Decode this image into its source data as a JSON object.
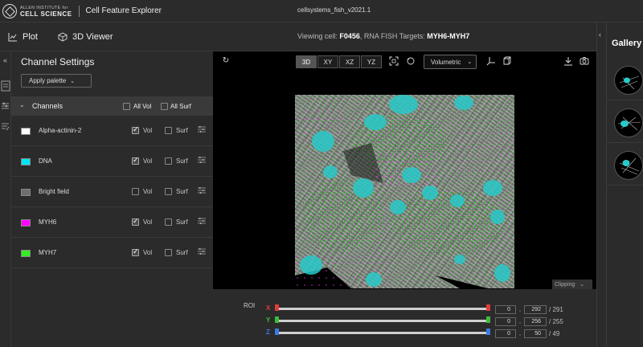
{
  "header": {
    "logo_small": "ALLEN INSTITUTE for",
    "logo_big": "CELL SCIENCE",
    "app_name": "Cell Feature Explorer",
    "dataset": "cellsystems_fish_v2021.1"
  },
  "nav": {
    "tabs": [
      {
        "label": "Plot",
        "icon": "chart-icon"
      },
      {
        "label": "3D Viewer",
        "icon": "cube-icon"
      }
    ],
    "viewing_prefix": "Viewing cell:",
    "cell_id": "F0456",
    "targets_prefix": ", RNA FISH Targets:",
    "targets": "MYH6-MYH7"
  },
  "channel_settings": {
    "title": "Channel Settings",
    "palette_button": "Apply palette",
    "header_label": "Channels",
    "all_vol": "All Vol",
    "all_surf": "All Surf",
    "vol_label": "Vol",
    "surf_label": "Surf",
    "channels": [
      {
        "name": "Alpha-actinin-2",
        "color": "#ffffff",
        "vol": true,
        "surf": false
      },
      {
        "name": "DNA",
        "color": "#00e5f2",
        "vol": true,
        "surf": false
      },
      {
        "name": "Bright field",
        "color": "#6e6e6e",
        "vol": false,
        "surf": false
      },
      {
        "name": "MYH6",
        "color": "#ff00ff",
        "vol": true,
        "surf": false
      },
      {
        "name": "MYH7",
        "color": "#33ee22",
        "vol": true,
        "surf": false
      }
    ]
  },
  "viewer": {
    "modes": [
      "3D",
      "XY",
      "XZ",
      "YZ"
    ],
    "active_mode": "3D",
    "render_mode": "Volumetric",
    "clipping_label": "Clipping"
  },
  "roi": {
    "label": "ROI",
    "axes": [
      {
        "name": "X",
        "color": "#e23b3b",
        "min": "0",
        "max": "292",
        "limit": "/ 291"
      },
      {
        "name": "Y",
        "color": "#3bbf3b",
        "min": "0",
        "max": "256",
        "limit": "/ 255"
      },
      {
        "name": "Z",
        "color": "#3b7be2",
        "min": "0",
        "max": "50",
        "limit": "/ 49"
      }
    ]
  },
  "gallery": {
    "title": "Gallery"
  }
}
